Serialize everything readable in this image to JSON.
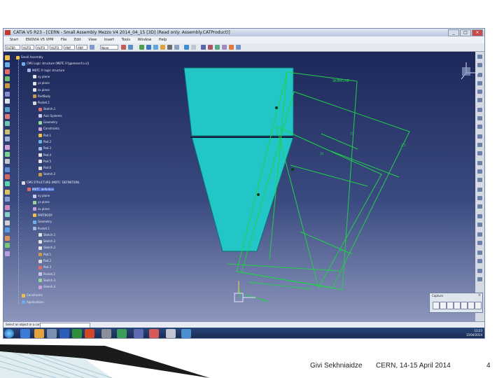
{
  "window": {
    "title": "CATIA V5 R23 - [CERN - Small Assembly   Mezzo   V4   2014_04_15 [3D] (Read only: Assembly.CATProduct)]",
    "buttons": [
      "_",
      "□",
      "×"
    ]
  },
  "menubar": [
    "Start",
    "ENOVIA V5 VPM",
    "File",
    "Edit",
    "View",
    "Insert",
    "Tools",
    "Window",
    "Help"
  ],
  "toolbar": {
    "filters": [
      "FILTER",
      "AUTO",
      "AUTO",
      "AUTO",
      "ANY",
      "ANY"
    ],
    "standard": "None"
  },
  "tree": {
    "nodes": [
      {
        "label": "Small Assembly",
        "depth": 0
      },
      {
        "label": "CMS Logic structure (MBTC Fr[gamesvrf.o.s])",
        "depth": 1
      },
      {
        "label": "MBTC Fr logic structure",
        "depth": 2
      },
      {
        "label": "xy plane",
        "depth": 3
      },
      {
        "label": "yz plane",
        "depth": 3
      },
      {
        "label": "zx plane",
        "depth": 3
      },
      {
        "label": "PartBody",
        "depth": 3
      },
      {
        "label": "Pocket.1",
        "depth": 3
      },
      {
        "label": "Sketch.1",
        "depth": 4
      },
      {
        "label": "Axis Systems",
        "depth": 4
      },
      {
        "label": "Geometry",
        "depth": 4
      },
      {
        "label": "Constraints",
        "depth": 4
      },
      {
        "label": "Pad.1",
        "depth": 4
      },
      {
        "label": "Pad.2",
        "depth": 4
      },
      {
        "label": "Pad.3",
        "depth": 4
      },
      {
        "label": "Pad.4",
        "depth": 4
      },
      {
        "label": "Pad.5",
        "depth": 4
      },
      {
        "label": "Pad.6",
        "depth": 4
      },
      {
        "label": "Sketch.2",
        "depth": 4
      },
      {
        "label": "CMS STRUCTURE (MBTC: DEFINITION)",
        "depth": 1
      },
      {
        "label": "MBTC definition",
        "depth": 2,
        "selected": true
      },
      {
        "label": "xy plane",
        "depth": 3
      },
      {
        "label": "yz plane",
        "depth": 3
      },
      {
        "label": "zx plane",
        "depth": 3
      },
      {
        "label": "PARTBODY",
        "depth": 3
      },
      {
        "label": "Geometry",
        "depth": 3
      },
      {
        "label": "Pocket.1",
        "depth": 3
      },
      {
        "label": "Sketch.1",
        "depth": 4
      },
      {
        "label": "Sketch.2",
        "depth": 4
      },
      {
        "label": "Sketch.3",
        "depth": 4
      },
      {
        "label": "Pad.1",
        "depth": 4
      },
      {
        "label": "Pad.2",
        "depth": 4
      },
      {
        "label": "Pad.3",
        "depth": 4
      },
      {
        "label": "Pocket.2",
        "depth": 4
      },
      {
        "label": "Sketch.3",
        "depth": 4
      },
      {
        "label": "Sketch.4",
        "depth": 4
      },
      {
        "label": "Constraints",
        "depth": 1
      },
      {
        "label": "Applications",
        "depth": 1
      }
    ]
  },
  "geometry_labels": {
    "top_green_label": "SKBM14E",
    "dim_labels": [
      "35",
      "73",
      "2.5",
      "30",
      "60"
    ]
  },
  "statusbar": {
    "prompt": "Select an object or a command"
  },
  "capture_toolbar": {
    "title": "Capture",
    "close": "×"
  },
  "taskbar": {
    "time": "13:23",
    "date": "15/04/2014"
  },
  "footer": {
    "author": "Givi Sekhniaidze",
    "event": "CERN, 14-15 April 2014",
    "page": "4"
  },
  "colors": {
    "viewport_top": "#1d2859",
    "part_fill": "#22c6c7",
    "sketch_green": "#22d04a",
    "selected_node": "#3f64c9"
  }
}
